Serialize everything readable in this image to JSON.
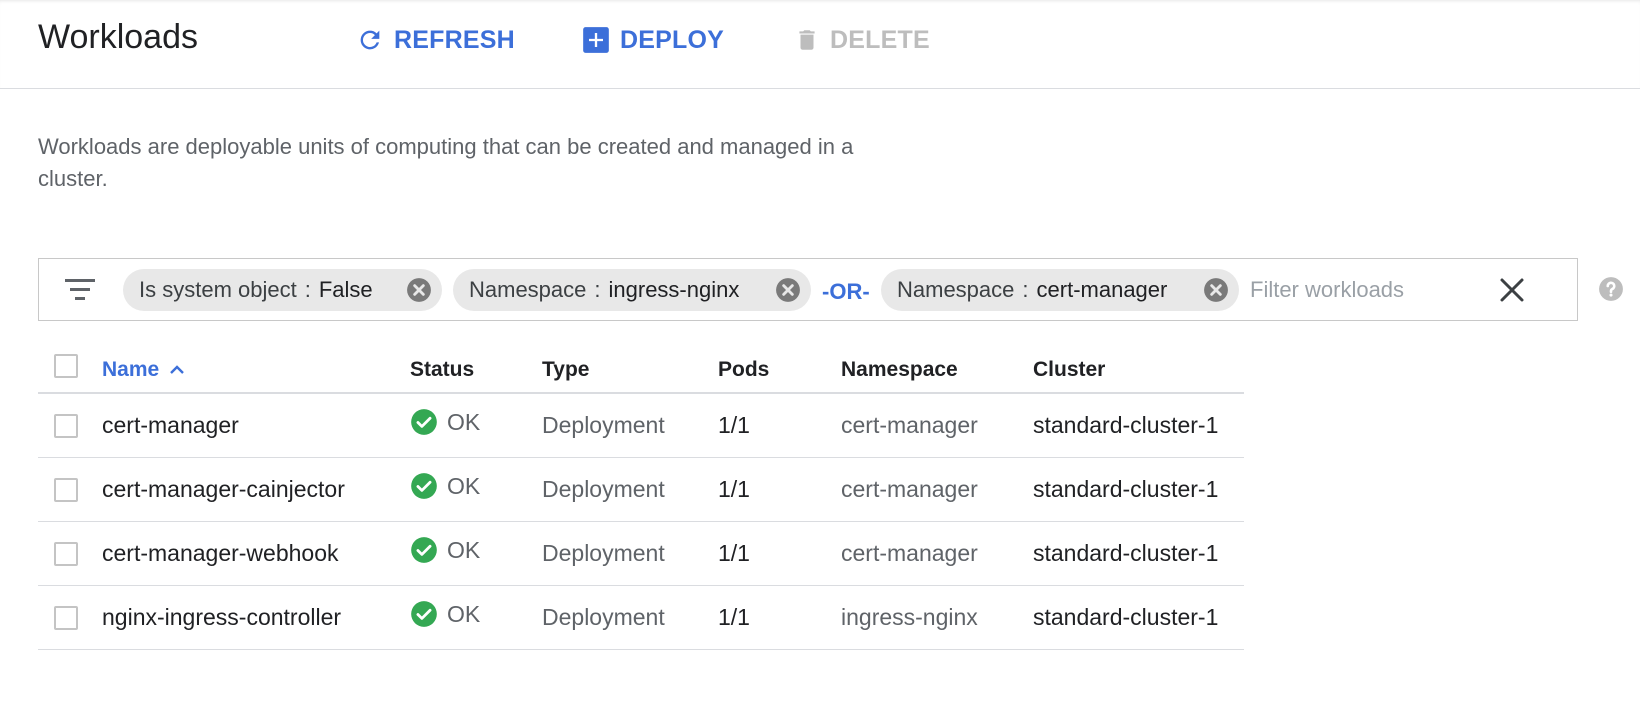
{
  "header": {
    "title": "Workloads",
    "refresh_label": "REFRESH",
    "deploy_label": "DEPLOY",
    "delete_label": "DELETE"
  },
  "description": "Workloads are deployable units of computing that can be created and managed in a cluster.",
  "filter": {
    "chips": [
      {
        "key": "Is system object",
        "sep": ":",
        "value": "False"
      },
      {
        "key": "Namespace",
        "sep": ":",
        "value": "ingress-nginx"
      },
      {
        "key": "Namespace",
        "sep": ":",
        "value": "cert-manager"
      }
    ],
    "or_label": "-OR-",
    "placeholder": "Filter workloads"
  },
  "table": {
    "columns": {
      "name": "Name",
      "status": "Status",
      "type": "Type",
      "pods": "Pods",
      "namespace": "Namespace",
      "cluster": "Cluster"
    },
    "rows": [
      {
        "name": "cert-manager",
        "status": "OK",
        "type": "Deployment",
        "pods": "1/1",
        "namespace": "cert-manager",
        "cluster": "standard-cluster-1"
      },
      {
        "name": "cert-manager-cainjector",
        "status": "OK",
        "type": "Deployment",
        "pods": "1/1",
        "namespace": "cert-manager",
        "cluster": "standard-cluster-1"
      },
      {
        "name": "cert-manager-webhook",
        "status": "OK",
        "type": "Deployment",
        "pods": "1/1",
        "namespace": "cert-manager",
        "cluster": "standard-cluster-1"
      },
      {
        "name": "nginx-ingress-controller",
        "status": "OK",
        "type": "Deployment",
        "pods": "1/1",
        "namespace": "ingress-nginx",
        "cluster": "standard-cluster-1"
      }
    ]
  },
  "colors": {
    "accent": "#3c6fd9",
    "ok_green": "#34a853",
    "disabled": "#bdbdbd"
  },
  "icons": {
    "refresh": "refresh-icon",
    "deploy": "add-box-icon",
    "delete": "trash-icon",
    "filter": "filter-list-icon",
    "chip_remove": "cancel-circle-icon",
    "clear": "close-icon",
    "help": "help-circle-icon",
    "sort": "chevron-up-icon",
    "status_ok": "check-circle-icon"
  }
}
